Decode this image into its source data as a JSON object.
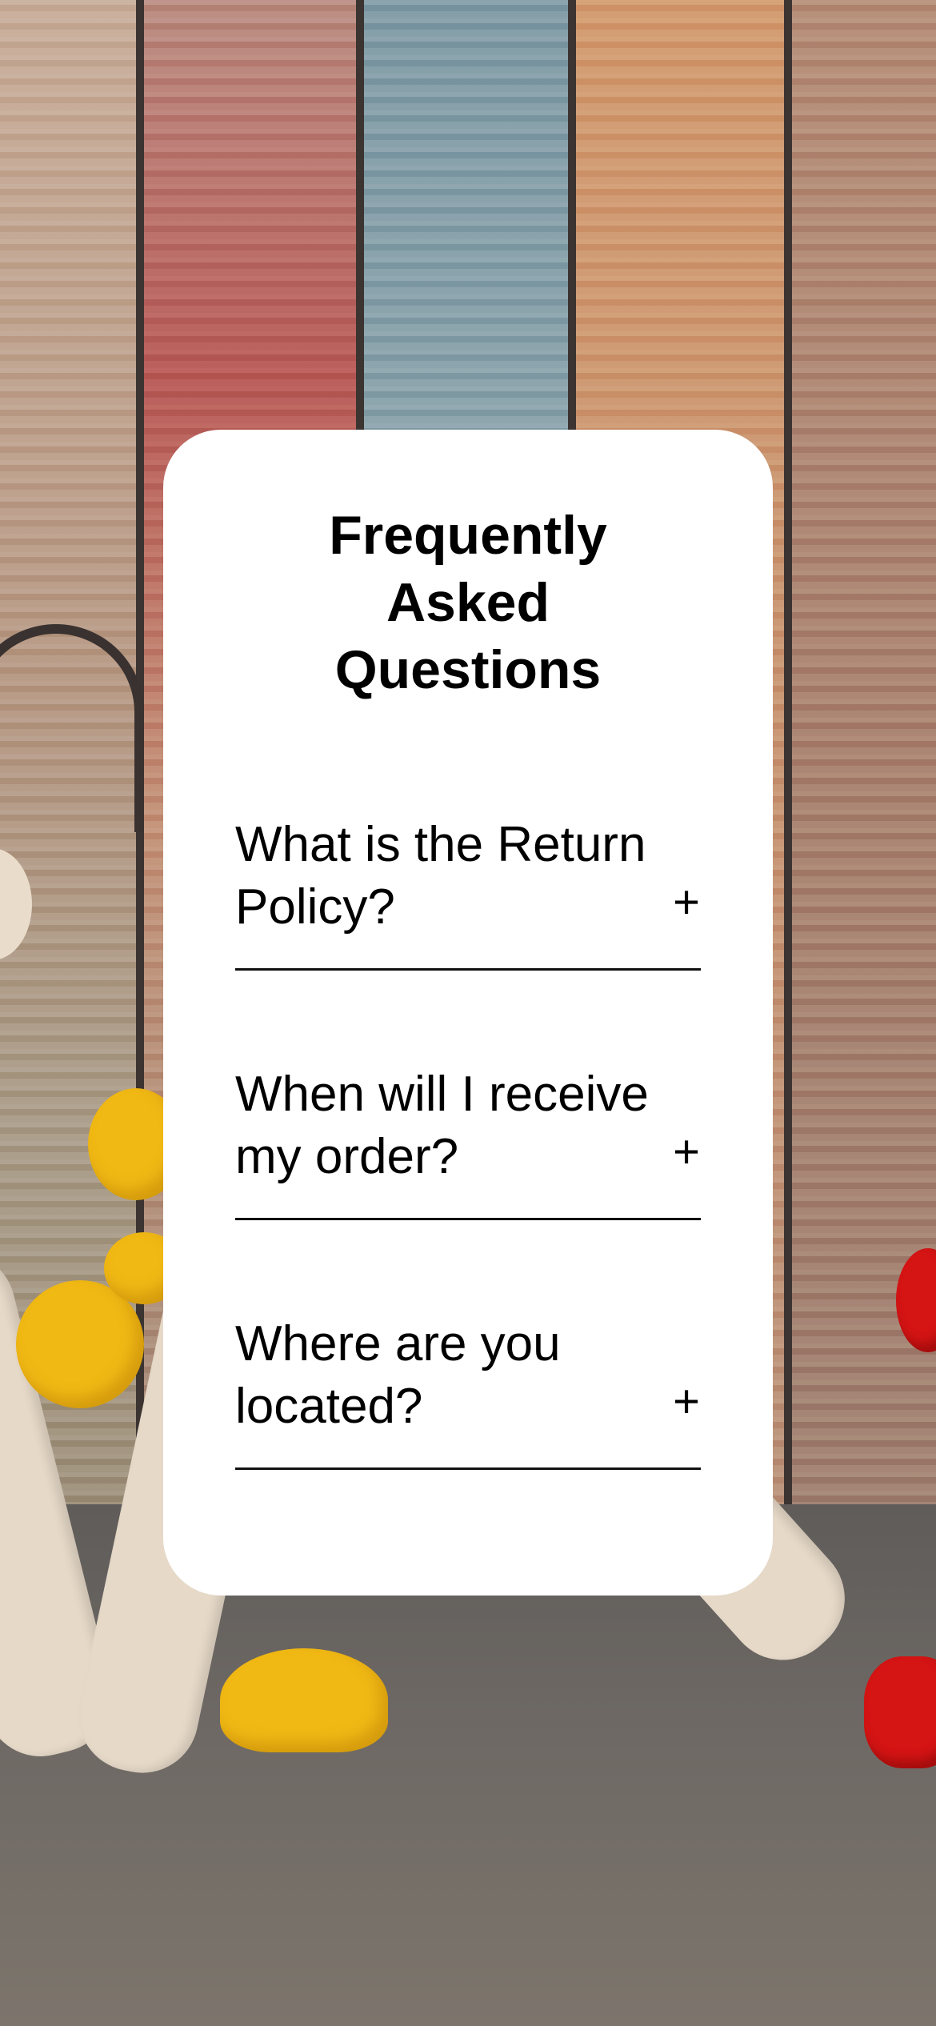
{
  "faq": {
    "title": "Frequently Asked Questions",
    "items": [
      {
        "question": "What is the Return Policy?",
        "toggle": "+"
      },
      {
        "question": "When will I receive my order?",
        "toggle": "+"
      },
      {
        "question": "Where are you located?",
        "toggle": "+"
      }
    ]
  },
  "colors": {
    "card_background": "#ffffff",
    "text": "#000000"
  },
  "icons": {
    "toggle": "plus-icon"
  }
}
